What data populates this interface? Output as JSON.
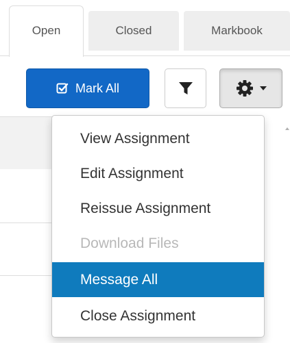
{
  "tabs": [
    {
      "label": "Open",
      "active": true
    },
    {
      "label": "Closed",
      "active": false
    },
    {
      "label": "Markbook",
      "active": false
    }
  ],
  "toolbar": {
    "mark_all_label": "Mark All",
    "mark_all_icon": "check-square-icon",
    "filter_icon": "filter-icon",
    "settings_icon": "gear-icon",
    "caret_icon": "caret-down-icon"
  },
  "menu": {
    "items": [
      {
        "label": "View Assignment",
        "state": "normal"
      },
      {
        "label": "Edit Assignment",
        "state": "normal"
      },
      {
        "label": "Reissue Assignment",
        "state": "normal"
      },
      {
        "label": "Download Files",
        "state": "disabled"
      },
      {
        "label": "Message All",
        "state": "highlighted"
      },
      {
        "label": "Close Assignment",
        "state": "normal"
      }
    ]
  },
  "colors": {
    "primary": "#1268c6",
    "menu_highlight": "#0f7bbd",
    "disabled_text": "#b8b8b8"
  }
}
